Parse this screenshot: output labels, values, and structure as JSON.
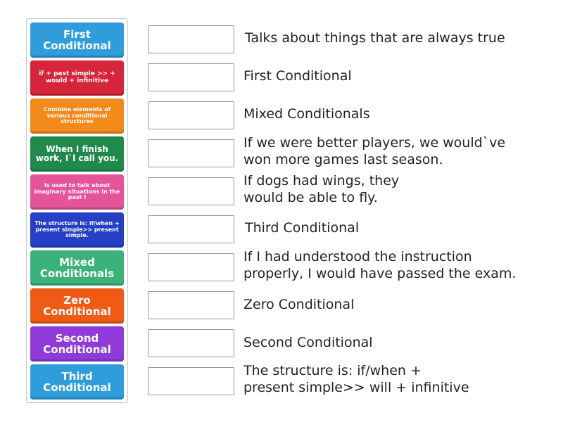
{
  "tiles": [
    {
      "label": "First\nConditional",
      "color": "#2f9cdc"
    },
    {
      "label": "if + past simple >> + would + infinitive",
      "color": "#d6243a"
    },
    {
      "label": "Combine elements of various conditional structures",
      "color": "#f28a1c"
    },
    {
      "label": "When I finish work, I`l call you.",
      "color": "#1f8a4c"
    },
    {
      "label": "Is used to talk about imaginary situations in the past I",
      "color": "#e5539a"
    },
    {
      "label": "The structure is: if/when + present simple>> present simple.",
      "color": "#2540c7"
    },
    {
      "label": "Mixed\nConditionals",
      "color": "#3bb27a"
    },
    {
      "label": "Zero\nConditional",
      "color": "#ef5a14"
    },
    {
      "label": "Second\nConditional",
      "color": "#8e3bd9"
    },
    {
      "label": "Third\nConditional",
      "color": "#2f9cdc"
    }
  ],
  "descriptions": [
    "Talks about things that are always true",
    "First Conditional",
    "Mixed Conditionals",
    "If we were better players, we would`ve\nwon more games last season.",
    "If dogs had wings, they\nwould be able to fly.",
    "Third Conditional",
    "If I had understood the instruction\nproperly, I would have passed the exam.",
    "Zero Conditional",
    "Second Conditional",
    "The structure is: if/when +\npresent simple>> will + infinitive"
  ]
}
